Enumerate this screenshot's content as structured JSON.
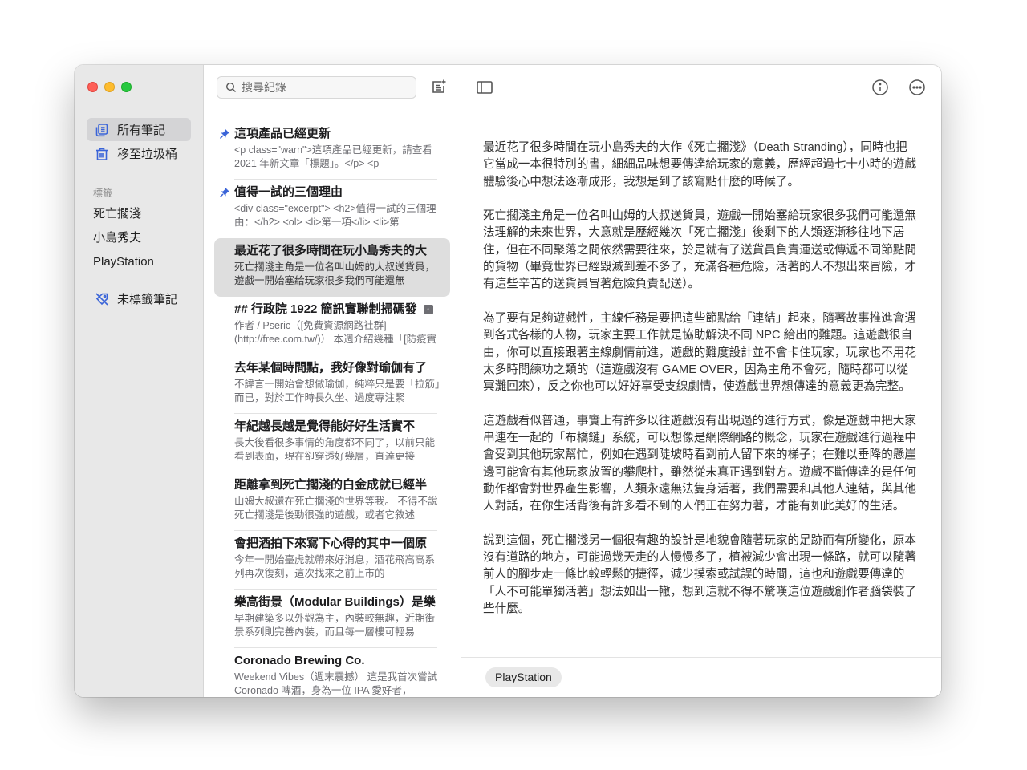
{
  "window": {
    "traffic_lights": [
      "close",
      "minimize",
      "zoom"
    ]
  },
  "sidebar": {
    "nav": [
      {
        "label": "所有筆記",
        "icon": "notes-icon",
        "active": true
      },
      {
        "label": "移至垃圾桶",
        "icon": "trash-icon",
        "active": false
      }
    ],
    "tags_heading": "標籤",
    "tags": [
      "死亡擱淺",
      "小島秀夫",
      "PlayStation"
    ],
    "untagged": {
      "label": "未標籤筆記",
      "icon": "untagged-icon"
    }
  },
  "list": {
    "search": {
      "placeholder": "搜尋紀錄",
      "value": ""
    },
    "new_note_icon": "new-note-icon",
    "notes": [
      {
        "title": "這項產品已經更新",
        "excerpt": "<p class=\"warn\">這項產品已經更新，請查看 2021 年新文章「標題」。</p> <p",
        "pinned": true,
        "selected": false
      },
      {
        "title": "值得一試的三個理由",
        "excerpt": "<div class=\"excerpt\"> <h2>值得一試的三個理由：</h2> <ol> <li>第一項</li> <li>第",
        "pinned": true,
        "selected": false
      },
      {
        "title": "最近花了很多時間在玩小島秀夫的大",
        "excerpt": "死亡擱淺主角是一位名叫山姆的大叔送貨員，遊戲一開始塞給玩家很多我們可能還無",
        "pinned": false,
        "selected": true
      },
      {
        "title": "## 行政院 1922 簡訊實聯制掃碼發",
        "excerpt": "作者 / Pseric（[免費資源網路社群](http://free.com.tw/)） 本週介紹幾種「[防疫實聯",
        "pinned": false,
        "selected": false,
        "badge": "up-arrow-icon"
      },
      {
        "title": "去年某個時間點，我好像對瑜伽有了",
        "excerpt": "不諱言一開始會想做瑜伽，純粹只是要「拉筋」而已，對於工作時長久坐、過度專注緊",
        "pinned": false,
        "selected": false
      },
      {
        "title": "年紀越長越是覺得能好好生活實不",
        "excerpt": "長大後看很多事情的角度都不同了，以前只能看到表面，現在卻穿透好幾層，直達更接",
        "pinned": false,
        "selected": false
      },
      {
        "title": "距離拿到死亡擱淺的白金成就已經半",
        "excerpt": "山姆大叔還在死亡擱淺的世界等我。 不得不說死亡擱淺是後勁很強的遊戲，或者它敘述",
        "pinned": false,
        "selected": false
      },
      {
        "title": "會把酒拍下來寫下心得的其中一個原",
        "excerpt": "今年一開始臺虎就帶來好消息，酒花飛高高系列再次復刻，這次找來之前上市的",
        "pinned": false,
        "selected": false
      },
      {
        "title": "樂高街景（Modular Buildings）是樂",
        "excerpt": "早期建築多以外觀為主，內裝較無趣，近期街景系列則完善內裝，而且每一層樓可輕易",
        "pinned": false,
        "selected": false
      },
      {
        "title": "Coronado Brewing Co.",
        "excerpt": "Weekend Vibes（週末震撼） 這是我首次嘗試 Coronado 啤酒，身為一位 IPA 愛好者，",
        "pinned": false,
        "selected": false
      }
    ]
  },
  "editor": {
    "toolbar": {
      "sidebar_toggle_icon": "sidebar-toggle-icon",
      "info_icon": "info-icon",
      "more_icon": "more-icon"
    },
    "paragraphs": [
      "最近花了很多時間在玩小島秀夫的大作《死亡擱淺》（Death Stranding），同時也把它當成一本很特別的書，細細品味想要傳達給玩家的意義，歷經超過七十小時的遊戲體驗後心中想法逐漸成形，我想是到了該寫點什麼的時候了。",
      "死亡擱淺主角是一位名叫山姆的大叔送貨員，遊戲一開始塞給玩家很多我們可能還無法理解的未來世界，大意就是歷經幾次「死亡擱淺」後剩下的人類逐漸移往地下居住，但在不同聚落之間依然需要往來，於是就有了送貨員負責運送或傳遞不同節點間的貨物（畢竟世界已經毀滅到差不多了，充滿各種危險，活著的人不想出來冒險，才有這些辛苦的送貨員冒著危險負責配送）。",
      "為了要有足夠遊戲性，主線任務是要把這些節點給「連結」起來，隨著故事推進會遇到各式各樣的人物，玩家主要工作就是協助解決不同 NPC 給出的難題。這遊戲很自由，你可以直接跟著主線劇情前進，遊戲的難度設計並不會卡住玩家，玩家也不用花太多時間練功之類的（這遊戲沒有 GAME OVER，因為主角不會死，隨時都可以從冥灘回來），反之你也可以好好享受支線劇情，使遊戲世界想傳達的意義更為完整。",
      "這遊戲看似普通，事實上有許多以往遊戲沒有出現過的進行方式，像是遊戲中把大家串連在一起的「布橋鏈」系統，可以想像是網際網路的概念，玩家在遊戲進行過程中會受到其他玩家幫忙，例如在遇到陡坡時看到前人留下來的梯子；在難以垂降的懸崖邊可能會有其他玩家放置的攀爬柱，雖然從未真正遇到對方。遊戲不斷傳達的是任何動作都會對世界產生影響，人類永遠無法隻身活著，我們需要和其他人連結，與其他人對話，在你生活背後有許多看不到的人們正在努力著，才能有如此美好的生活。",
      "說到這個，死亡擱淺另一個很有趣的設計是地貌會隨著玩家的足跡而有所變化，原本沒有道路的地方，可能過幾天走的人慢慢多了，植被減少會出現一條路，就可以隨著前人的腳步走一條比較輕鬆的捷徑，減少摸索或試誤的時間，這也和遊戲要傳達的「人不可能單獨活著」想法如出一轍，想到這就不得不驚嘆這位遊戲創作者腦袋裝了些什麼。"
    ],
    "tags": [
      "PlayStation"
    ]
  },
  "colors": {
    "accent": "#3a64d8",
    "sidebar_bg": "#e8e8e8",
    "selected_bg": "#dedede",
    "close": "#fe5f57",
    "minimize": "#febc2e",
    "zoom": "#28c840"
  }
}
